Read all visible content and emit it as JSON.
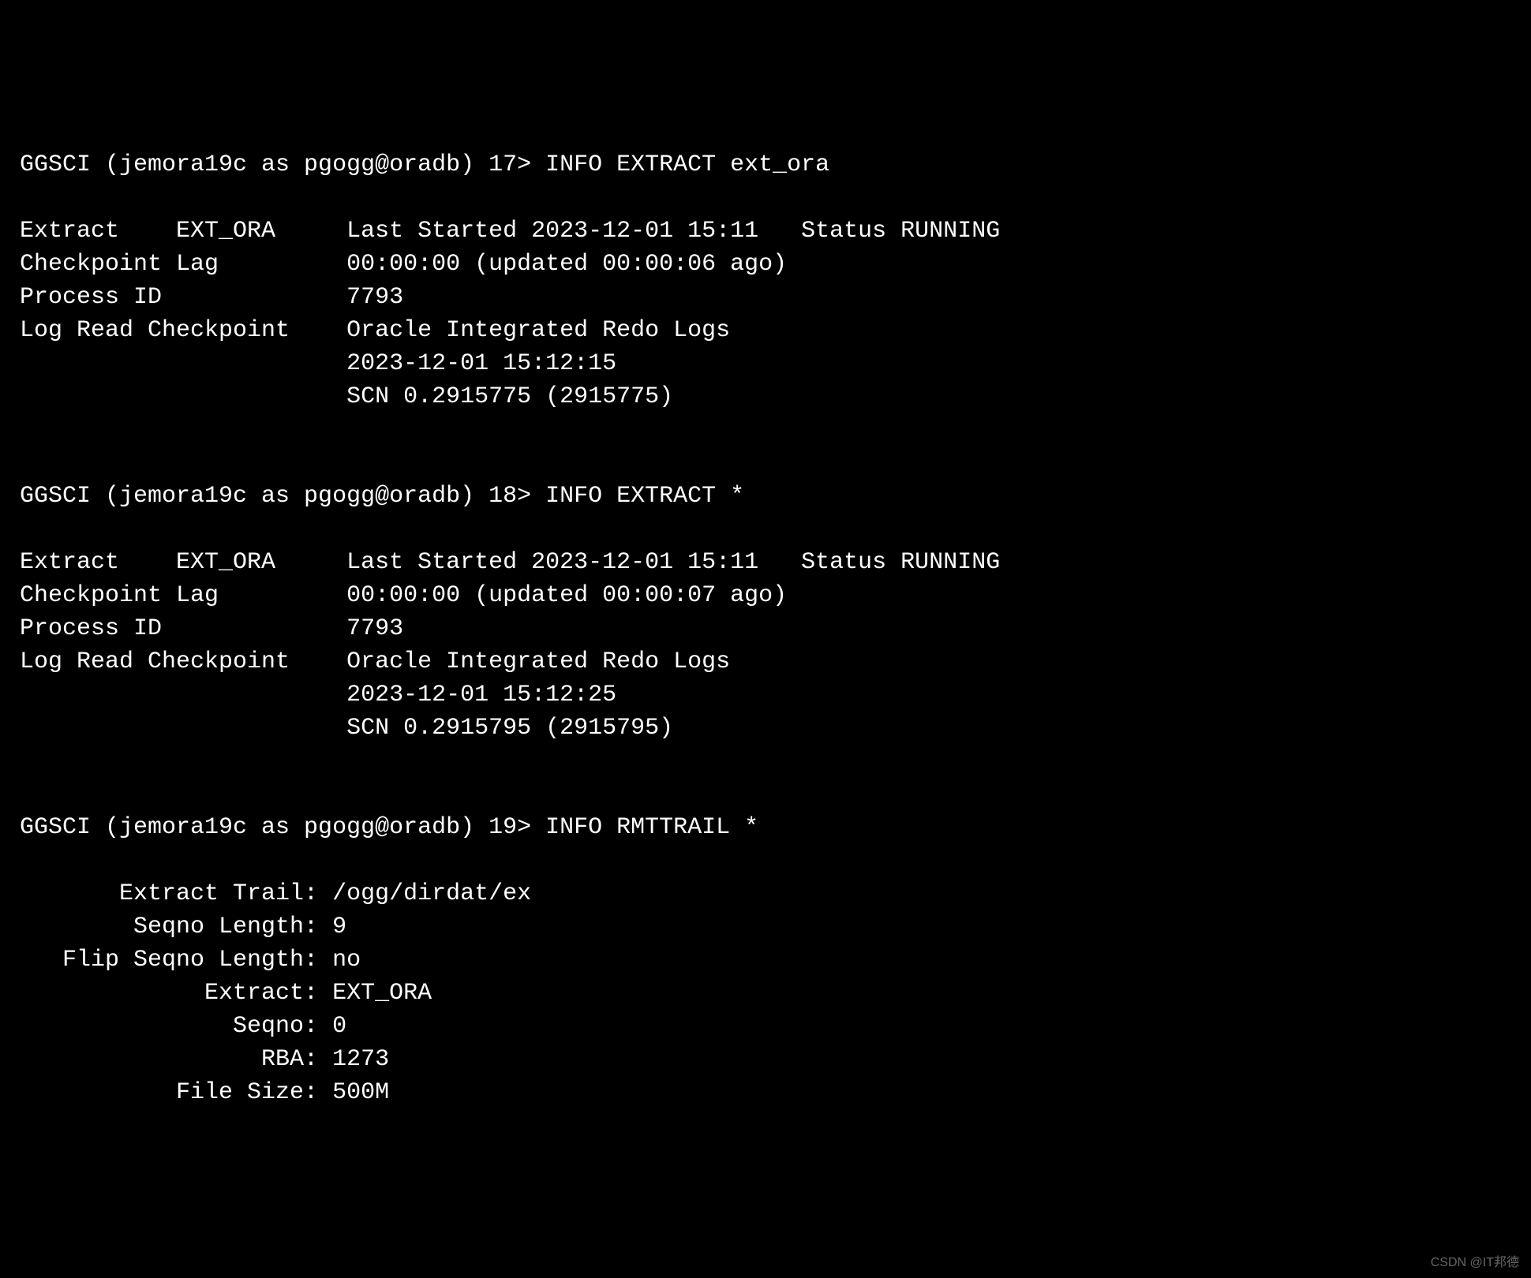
{
  "prompt1": {
    "prefix": "GGSCI (jemora19c as pgogg@oradb) 17> ",
    "command": "INFO EXTRACT ext_ora"
  },
  "block1": {
    "line1": "Extract    EXT_ORA     Last Started 2023-12-01 15:11   Status RUNNING",
    "line2": "Checkpoint Lag         00:00:00 (updated 00:00:06 ago)",
    "line3": "Process ID             7793",
    "line4": "Log Read Checkpoint    Oracle Integrated Redo Logs",
    "line5": "                       2023-12-01 15:12:15",
    "line6": "                       SCN 0.2915775 (2915775)"
  },
  "prompt2": {
    "prefix": "GGSCI (jemora19c as pgogg@oradb) 18> ",
    "command": "INFO EXTRACT *"
  },
  "block2": {
    "line1": "Extract    EXT_ORA     Last Started 2023-12-01 15:11   Status RUNNING",
    "line2": "Checkpoint Lag         00:00:00 (updated 00:00:07 ago)",
    "line3": "Process ID             7793",
    "line4": "Log Read Checkpoint    Oracle Integrated Redo Logs",
    "line5": "                       2023-12-01 15:12:25",
    "line6": "                       SCN 0.2915795 (2915795)"
  },
  "prompt3": {
    "prefix": "GGSCI (jemora19c as pgogg@oradb) 19> ",
    "command": "INFO RMTTRAIL *"
  },
  "block3": {
    "line1": "       Extract Trail: /ogg/dirdat/ex",
    "line2": "        Seqno Length: 9",
    "line3": "   Flip Seqno Length: no",
    "line4": "             Extract: EXT_ORA",
    "line5": "               Seqno: 0",
    "line6": "                 RBA: 1273",
    "line7": "           File Size: 500M"
  },
  "watermark": "CSDN @IT邦德"
}
